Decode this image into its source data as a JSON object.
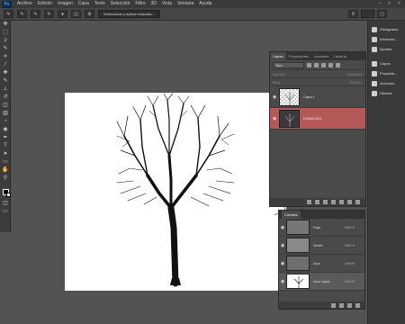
{
  "app": {
    "logo": "Ps"
  },
  "menu": [
    "Archivo",
    "Edición",
    "Imagen",
    "Capa",
    "Texto",
    "Selección",
    "Filtro",
    "3D",
    "Vista",
    "Ventana",
    "Ayuda"
  ],
  "window_controls": [
    "–",
    "□",
    "×"
  ],
  "options_bar": {
    "select_subject_label": "Seleccionar y aplicar máscara..."
  },
  "tools": [
    "move-icon",
    "marquee-icon",
    "lasso-icon",
    "quick-select-icon",
    "crop-icon",
    "eyedropper-icon",
    "healing-icon",
    "brush-icon",
    "stamp-icon",
    "history-brush-icon",
    "eraser-icon",
    "gradient-icon",
    "blur-icon",
    "dodge-icon",
    "pen-icon",
    "type-icon",
    "path-select-icon",
    "shape-icon",
    "hand-icon",
    "zoom-icon"
  ],
  "tool_glyphs": [
    "✥",
    "⬚",
    "ↄ",
    "✎",
    "⌗",
    "⁄",
    "✚",
    "✎",
    "⊥",
    "↺",
    "◫",
    "▥",
    "◔",
    "◉",
    "✒",
    "T",
    "➤",
    "▭",
    "✋",
    "⚲"
  ],
  "layers_panel": {
    "tabs": [
      "Capas",
      "Propiedades",
      "Acciones",
      "Historia"
    ],
    "kind_select": "Tipo",
    "mode": "Normal",
    "opacity_label": "Opacidad:",
    "lock_label": "Bloq.:",
    "fill_label": "Relleno:",
    "layers": [
      {
        "name": "Capa 1",
        "visible_glyph": "◉"
      },
      {
        "name": "D1562-029",
        "visible_glyph": "◉"
      }
    ]
  },
  "channels_panel": {
    "title": "Canales",
    "channels": [
      {
        "name": "Rojo",
        "shortcut": "Ctrl+3"
      },
      {
        "name": "Verde",
        "shortcut": "Ctrl+4"
      },
      {
        "name": "Azul",
        "shortcut": "Ctrl+5"
      },
      {
        "name": "Azul copia",
        "shortcut": "Ctrl+6"
      }
    ]
  },
  "collapsed_panels": [
    {
      "label": "Histograma",
      "icon": "histogram-icon"
    },
    {
      "label": "Informaci...",
      "icon": "info-icon"
    },
    {
      "label": "Ajustes",
      "icon": "adjustments-icon"
    },
    {
      "label": "Capas",
      "icon": "layers-icon"
    },
    {
      "label": "Propieda...",
      "icon": "properties-icon"
    },
    {
      "label": "Acciones",
      "icon": "actions-icon"
    },
    {
      "label": "Historia",
      "icon": "history-icon"
    }
  ]
}
